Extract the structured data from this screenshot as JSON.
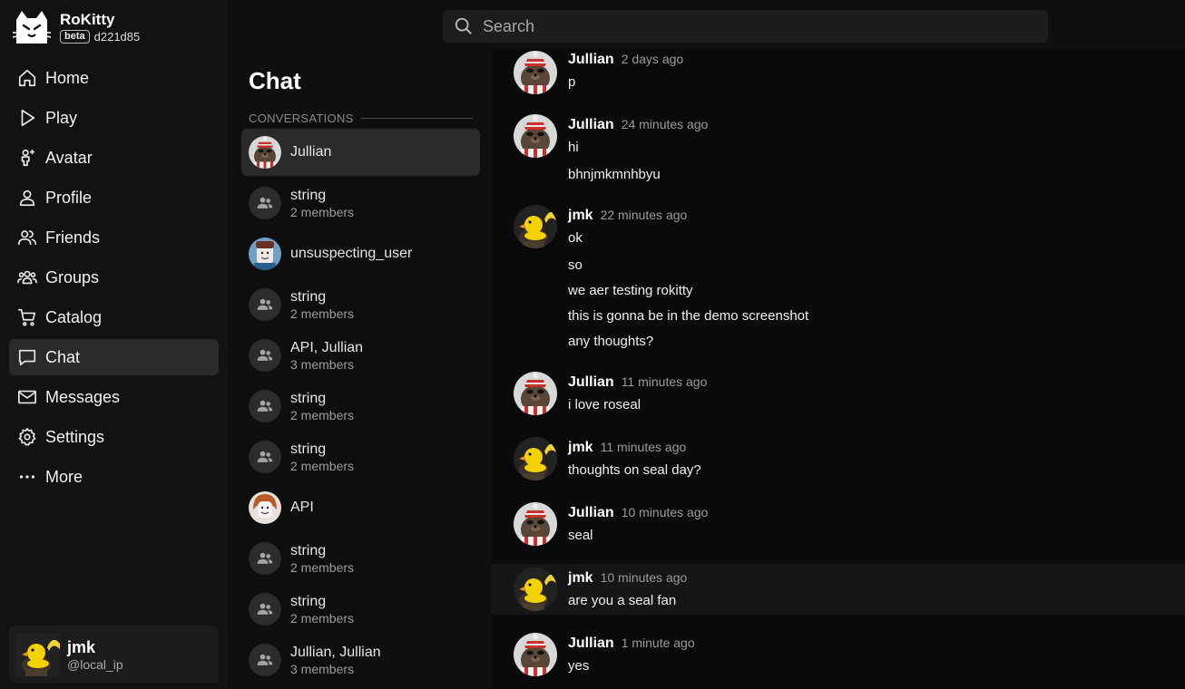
{
  "app": {
    "title": "RoKitty",
    "badge": "beta",
    "build": "d221d85"
  },
  "search": {
    "placeholder": "Search"
  },
  "nav": {
    "items": [
      {
        "label": "Home",
        "icon": "home-icon"
      },
      {
        "label": "Play",
        "icon": "play-icon"
      },
      {
        "label": "Avatar",
        "icon": "avatar-icon"
      },
      {
        "label": "Profile",
        "icon": "profile-icon"
      },
      {
        "label": "Friends",
        "icon": "friends-icon"
      },
      {
        "label": "Groups",
        "icon": "groups-icon"
      },
      {
        "label": "Catalog",
        "icon": "cart-icon"
      },
      {
        "label": "Chat",
        "icon": "chat-icon",
        "active": true
      },
      {
        "label": "Messages",
        "icon": "mail-icon"
      },
      {
        "label": "Settings",
        "icon": "gear-icon"
      },
      {
        "label": "More",
        "icon": "more-icon"
      }
    ]
  },
  "user": {
    "name": "jmk",
    "handle": "@local_ip"
  },
  "chat": {
    "title": "Chat",
    "section_label": "CONVERSATIONS",
    "conversations": [
      {
        "name": "Jullian",
        "members": "",
        "avatar": "seal",
        "active": true
      },
      {
        "name": "string",
        "members": "2 members",
        "avatar": "group"
      },
      {
        "name": "unsuspecting_user",
        "members": "",
        "avatar": "blocky"
      },
      {
        "name": "string",
        "members": "2 members",
        "avatar": "group"
      },
      {
        "name": "API, Jullian",
        "members": "3 members",
        "avatar": "group"
      },
      {
        "name": "string",
        "members": "2 members",
        "avatar": "group"
      },
      {
        "name": "string",
        "members": "2 members",
        "avatar": "group"
      },
      {
        "name": "API",
        "members": "",
        "avatar": "noob"
      },
      {
        "name": "string",
        "members": "2 members",
        "avatar": "group"
      },
      {
        "name": "string",
        "members": "2 members",
        "avatar": "group"
      },
      {
        "name": "Jullian, Jullian",
        "members": "3 members",
        "avatar": "group"
      }
    ]
  },
  "messages": [
    {
      "author": "Jullian",
      "time": "2 days ago",
      "avatar": "seal",
      "lines": [
        "p"
      ]
    },
    {
      "author": "Jullian",
      "time": "24 minutes ago",
      "avatar": "seal",
      "lines": [
        "hi",
        "bhnjmkmnhbyu"
      ]
    },
    {
      "author": "jmk",
      "time": "22 minutes ago",
      "avatar": "duck",
      "lines": [
        "ok",
        "so",
        "we aer testing rokitty",
        "this is gonna be in the demo screenshot",
        "any thoughts?"
      ]
    },
    {
      "author": "Jullian",
      "time": "11 minutes ago",
      "avatar": "seal",
      "lines": [
        "i love roseal"
      ]
    },
    {
      "author": "jmk",
      "time": "11 minutes ago",
      "avatar": "duck",
      "lines": [
        "thoughts on seal day?"
      ]
    },
    {
      "author": "Jullian",
      "time": "10 minutes ago",
      "avatar": "seal",
      "lines": [
        "seal"
      ]
    },
    {
      "author": "jmk",
      "time": "10 minutes ago",
      "avatar": "duck",
      "lines": [
        "are you a seal fan"
      ],
      "hover": true
    },
    {
      "author": "Jullian",
      "time": "1 minute ago",
      "avatar": "seal",
      "lines": [
        "yes"
      ]
    }
  ]
}
